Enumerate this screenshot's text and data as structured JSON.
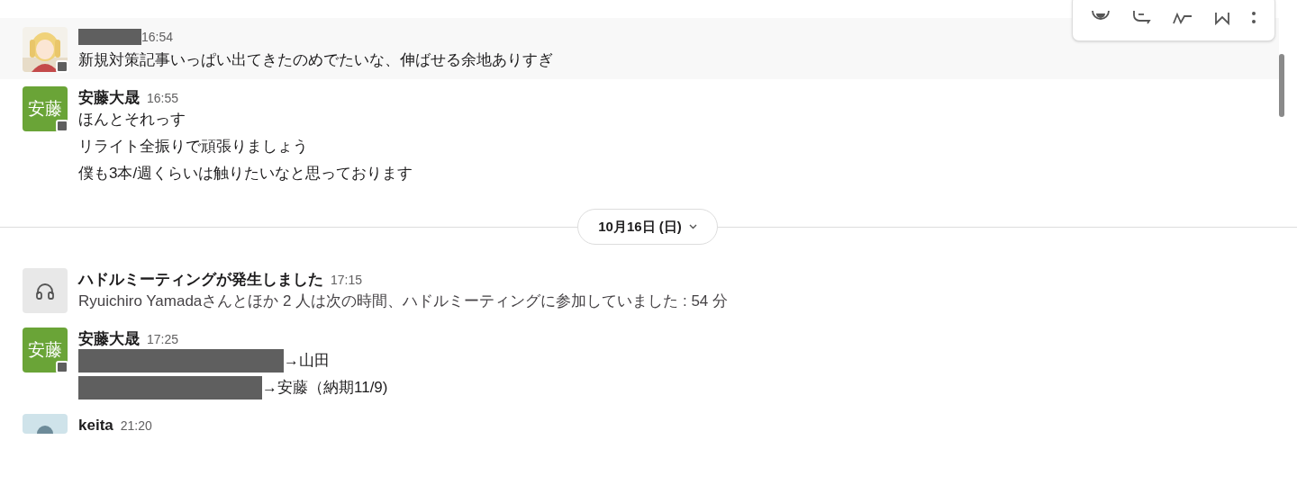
{
  "messages": [
    {
      "kind": "message",
      "avatar": {
        "kind": "picture"
      },
      "name_redacted": true,
      "time": "16:54",
      "hovered": true,
      "lines": [
        {
          "text": "新規対策記事いっぱい出てきたのめでたいな、伸ばせる余地ありすぎ",
          "redacted": false
        }
      ]
    },
    {
      "kind": "message",
      "avatar": {
        "kind": "initials",
        "text": "安藤",
        "color": "#6aa437"
      },
      "name": "安藤大晟",
      "time": "16:55",
      "hovered": false,
      "lines": [
        {
          "text": "ほんとそれっす",
          "redacted": false
        },
        {
          "text": "リライト全振りで頑張りましょう",
          "redacted": false
        },
        {
          "text": "僕も3本/週くらいは触りたいなと思っております",
          "redacted": false
        }
      ]
    },
    {
      "kind": "divider",
      "label": "10月16日 (日)"
    },
    {
      "kind": "huddle",
      "name": "ハドルミーティングが発生しました",
      "time": "17:15",
      "hovered": false,
      "lines": [
        {
          "text": "Ryuichiro Yamadaさんとほか 2 人は次の時間、ハドルミーティングに参加していました : 54 分",
          "redacted": false
        }
      ]
    },
    {
      "kind": "message",
      "avatar": {
        "kind": "initials",
        "text": "安藤",
        "color": "#6aa437"
      },
      "name": "安藤大晟",
      "time": "17:25",
      "hovered": false,
      "lines": [
        {
          "text": "→山田",
          "redacted": true
        },
        {
          "text": "→安藤（納期11/9)",
          "redacted": true
        }
      ]
    },
    {
      "kind": "message",
      "avatar": {
        "kind": "picture"
      },
      "name": "keita",
      "time": "21:20",
      "hovered": false,
      "cut": true
    }
  ]
}
